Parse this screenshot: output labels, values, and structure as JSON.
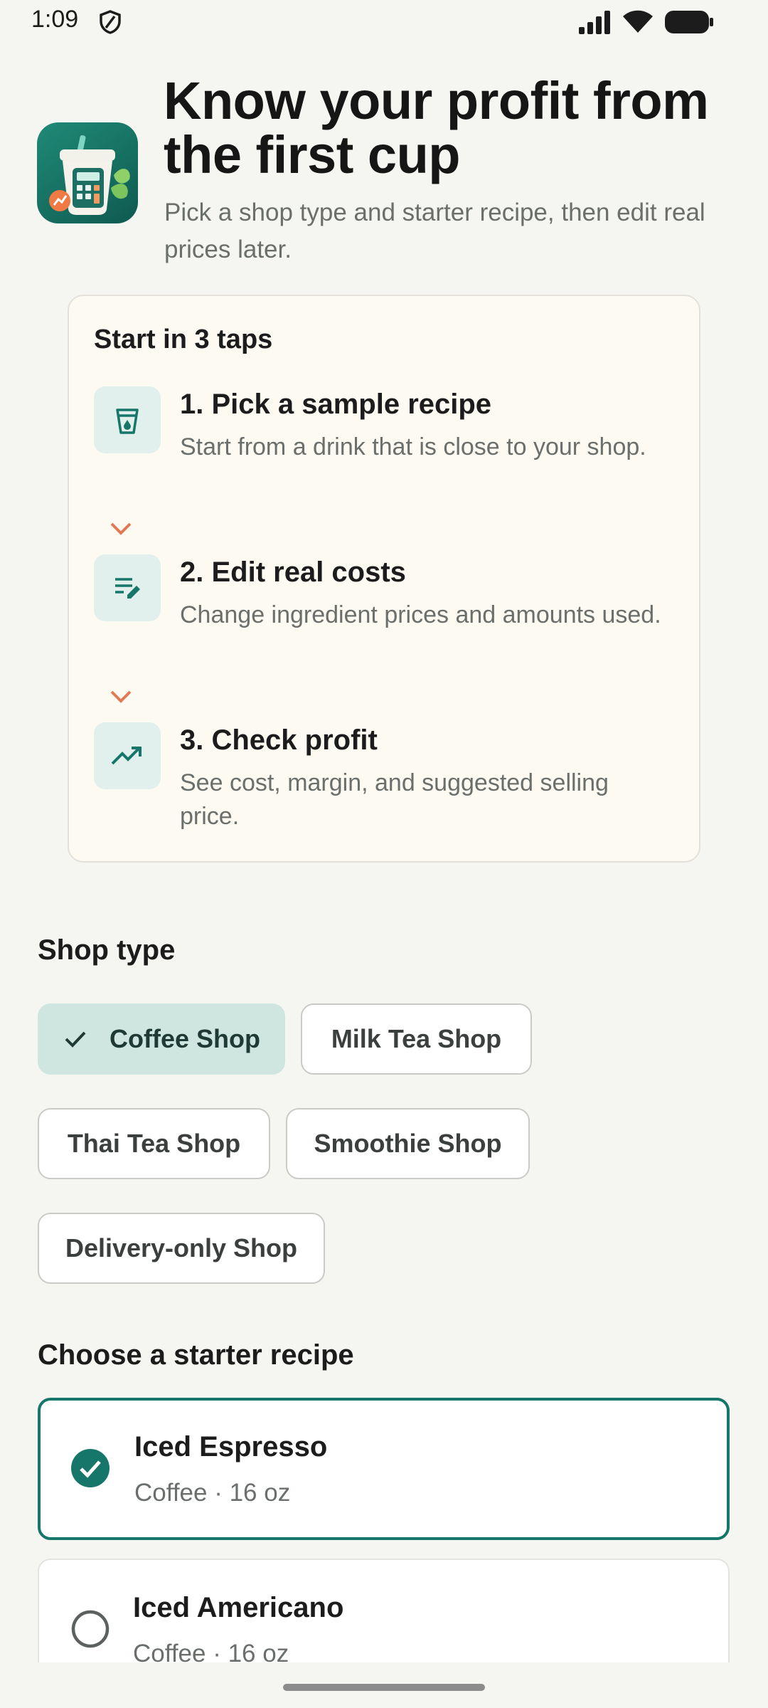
{
  "status_bar": {
    "time": "1:09"
  },
  "header": {
    "title": "Know your profit from the first cup",
    "subtitle": "Pick a shop type and starter recipe, then edit real prices later."
  },
  "steps": {
    "title": "Start in 3 taps",
    "items": [
      {
        "title": "1. Pick a sample recipe",
        "desc": "Start from a drink that is close to your shop.",
        "icon": "cup-icon"
      },
      {
        "title": "2. Edit real costs",
        "desc": "Change ingredient prices and amounts used.",
        "icon": "edit-list-icon"
      },
      {
        "title": "3. Check profit",
        "desc": "See cost, margin, and suggested selling price.",
        "icon": "trending-up-icon"
      }
    ]
  },
  "shop_type": {
    "heading": "Shop type",
    "options": [
      "Coffee Shop",
      "Milk Tea Shop",
      "Thai Tea Shop",
      "Smoothie Shop",
      "Delivery-only Shop"
    ],
    "selected": "Coffee Shop"
  },
  "recipes": {
    "heading": "Choose a starter recipe",
    "items": [
      {
        "name": "Iced Espresso",
        "meta": "Coffee · 16 oz",
        "selected": true
      },
      {
        "name": "Iced Americano",
        "meta": "Coffee · 16 oz",
        "selected": false
      }
    ]
  },
  "colors": {
    "accent": "#16766a",
    "chip_selected_bg": "#cfe6e0",
    "step_icon_bg": "#e1f0ec",
    "chevron": "#e07a55",
    "card_bg": "#fdfaf2",
    "page_bg": "#f5f5f1"
  }
}
